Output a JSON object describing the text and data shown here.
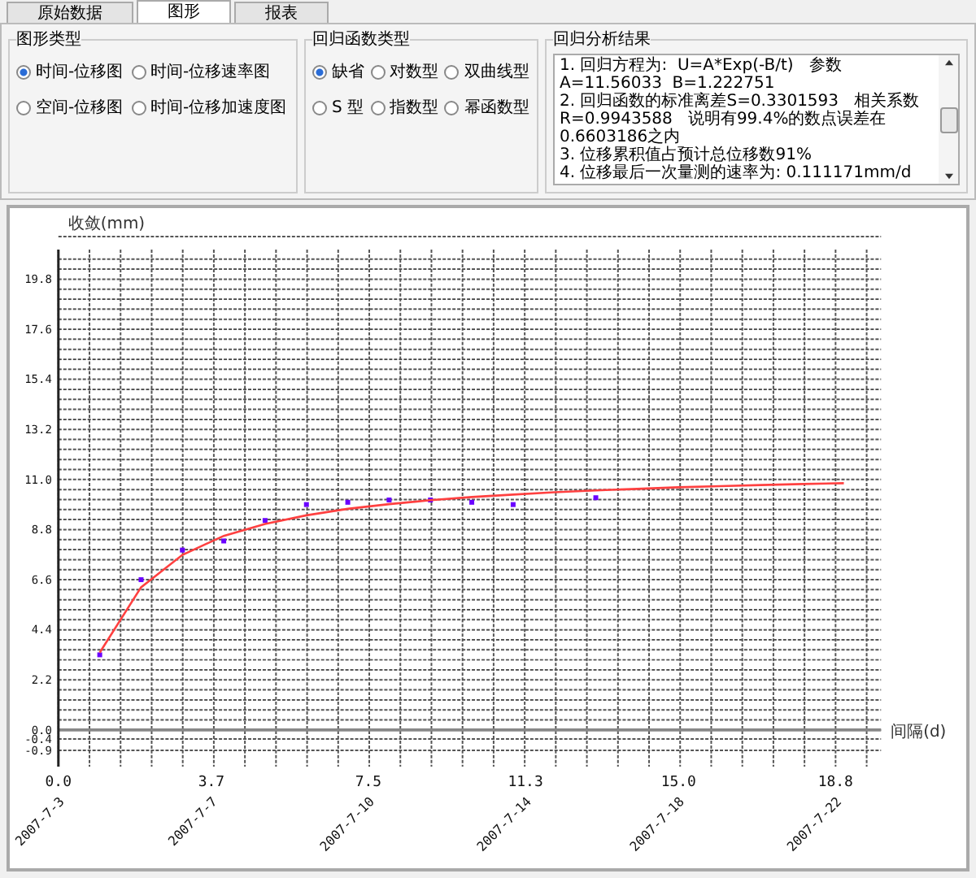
{
  "tabs": [
    {
      "label": "原始数据",
      "selected": false
    },
    {
      "label": "图形",
      "selected": true
    },
    {
      "label": "报表",
      "selected": false
    }
  ],
  "graph_type": {
    "title": "图形类型",
    "options": [
      {
        "label": "时间-位移图",
        "selected": true
      },
      {
        "label": "时间-位移速率图",
        "selected": false
      },
      {
        "label": "空间-位移图",
        "selected": false
      },
      {
        "label": "时间-位移加速度图",
        "selected": false
      }
    ]
  },
  "regression_type": {
    "title": "回归函数类型",
    "options": [
      {
        "label": "缺省",
        "selected": true
      },
      {
        "label": "对数型",
        "selected": false
      },
      {
        "label": "双曲线型",
        "selected": false
      },
      {
        "label": "S 型",
        "selected": false
      },
      {
        "label": "指数型",
        "selected": false
      },
      {
        "label": "幂函数型",
        "selected": false
      }
    ]
  },
  "analysis": {
    "title": "回归分析结果",
    "lines": [
      "1. 回归方程为:  U=A*Exp(-B/t)   参数A=11.56033  B=1.222751",
      "2. 回归函数的标准离差S=0.3301593   相关系数R=0.9943588   说明有99.4%的数点误差在0.6603186之内",
      "3. 位移累积值占预计总位移数91%",
      "4. 位移最后一次量测的速率为: 0.111171mm/d"
    ]
  },
  "chart": {
    "chart_data": {
      "type": "scatter",
      "ylabel": "收敛(mm)",
      "xlabel": "间隔(d)",
      "x": [
        1,
        2,
        3,
        4,
        5,
        6,
        7,
        8,
        9,
        10,
        11,
        12,
        13,
        14,
        15,
        16,
        17,
        18,
        19
      ],
      "series": [
        {
          "color": "#6a00ff",
          "values": [
            3.3,
            6.6,
            7.9,
            8.3,
            9.2,
            9.9,
            10.0,
            10.1,
            10.1,
            10.0,
            9.9,
            null,
            10.2,
            null,
            null,
            null,
            null,
            null,
            null
          ]
        },
        {
          "type": "line",
          "color": "#ff4040",
          "values": [
            3.4,
            6.27,
            7.69,
            8.52,
            9.05,
            9.43,
            9.71,
            9.92,
            10.09,
            10.23,
            10.34,
            10.44,
            10.52,
            10.59,
            10.66,
            10.71,
            10.76,
            10.8,
            10.84
          ]
        }
      ],
      "grid": true,
      "xlim": [
        0,
        19.9
      ],
      "ylim": [
        -0.9,
        21.1
      ],
      "xticks": [
        {
          "value": 0,
          "label": "0.0"
        },
        {
          "value": 3.7,
          "label": "3.7"
        },
        {
          "value": 7.5,
          "label": "7.5"
        },
        {
          "value": 11.3,
          "label": "11.3"
        },
        {
          "value": 15.0,
          "label": "15.0"
        },
        {
          "value": 18.8,
          "label": "18.8"
        }
      ],
      "yticks": [
        {
          "value": 19.8,
          "label": "19.8"
        },
        {
          "value": 17.6,
          "label": "17.6"
        },
        {
          "value": 15.4,
          "label": "15.4"
        },
        {
          "value": 13.2,
          "label": "13.2"
        },
        {
          "value": 11.0,
          "label": "11.0"
        },
        {
          "value": 8.8,
          "label": "8.8"
        },
        {
          "value": 6.6,
          "label": "6.6"
        },
        {
          "value": 4.4,
          "label": "4.4"
        },
        {
          "value": 2.2,
          "label": "2.2"
        },
        {
          "value": 0,
          "label": "0.0"
        },
        {
          "value": -0.4,
          "label": "-0.4"
        },
        {
          "value": -0.9,
          "label": "-0.9"
        }
      ]
    },
    "date_labels": [
      "2007-7-3",
      "2007-7-7",
      "2007-7-10",
      "2007-7-14",
      "2007-7-18",
      "2007-7-22"
    ]
  }
}
